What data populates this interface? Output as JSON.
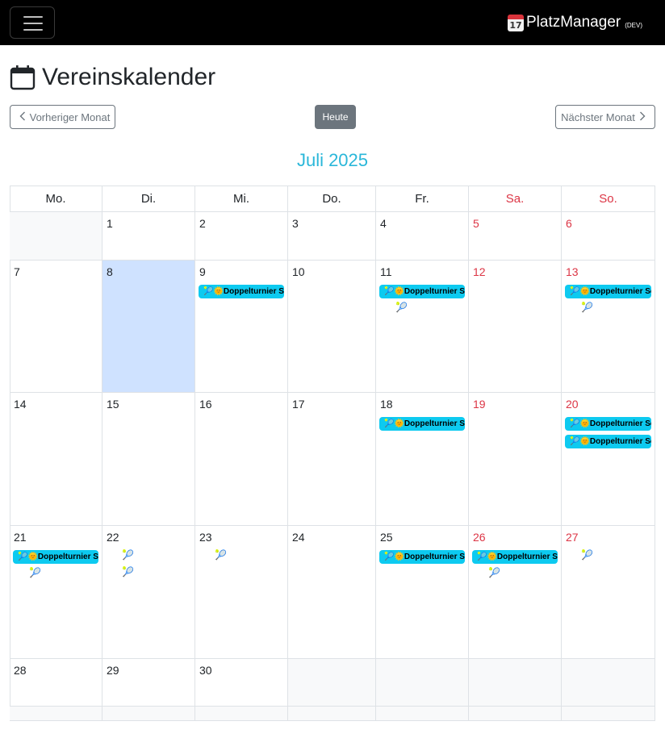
{
  "navbar": {
    "toggle_icon": "hamburger-icon",
    "brand_icon": "calendar-icon",
    "brand_icon_month": "July",
    "brand_icon_day": "17",
    "brand_name": "PlatzManager",
    "brand_tag": "(DEV)"
  },
  "page": {
    "title_icon": "calendar-icon",
    "title": "Vereinskalender"
  },
  "nav": {
    "prev_label": "Vorheriger Monat",
    "today_label": "Heute",
    "next_label": "Nächster Monat",
    "prev_icon": "chevron-left-icon",
    "next_icon": "chevron-right-icon"
  },
  "calendar": {
    "month_title": "Juli 2025",
    "accent_color": "#2ab7d9",
    "event_color": "#0dcaf0",
    "today_color": "#cfe2ff",
    "weekend_color": "#dc3545",
    "weekdays": [
      "Mo.",
      "Di.",
      "Mi.",
      "Do.",
      "Fr.",
      "Sa.",
      "So."
    ],
    "event_title": "🎾🌞Doppelturnier Sommer",
    "event_icon": "tennis-racket-icon",
    "today_day": 8,
    "weeks": [
      [
        {
          "day": "",
          "other": true,
          "events": [],
          "rackets": 0
        },
        {
          "day": "1",
          "events": [],
          "rackets": 0
        },
        {
          "day": "2",
          "events": [],
          "rackets": 0
        },
        {
          "day": "3",
          "events": [],
          "rackets": 0
        },
        {
          "day": "4",
          "events": [],
          "rackets": 0
        },
        {
          "day": "5",
          "weekend": true,
          "events": [],
          "rackets": 0
        },
        {
          "day": "6",
          "weekend": true,
          "events": [],
          "rackets": 0
        }
      ],
      [
        {
          "day": "7",
          "events": [],
          "rackets": 0
        },
        {
          "day": "8",
          "today": true,
          "events": [],
          "rackets": 0
        },
        {
          "day": "9",
          "events": [
            "Doppelturnier Sommer"
          ],
          "rackets": 0
        },
        {
          "day": "10",
          "events": [],
          "rackets": 0
        },
        {
          "day": "11",
          "events": [
            "Doppelturnier Sommer"
          ],
          "rackets": 1
        },
        {
          "day": "12",
          "weekend": true,
          "events": [],
          "rackets": 0
        },
        {
          "day": "13",
          "weekend": true,
          "events": [
            "Doppelturnier Sommer"
          ],
          "rackets": 1
        }
      ],
      [
        {
          "day": "14",
          "events": [],
          "rackets": 0
        },
        {
          "day": "15",
          "events": [],
          "rackets": 0
        },
        {
          "day": "16",
          "events": [],
          "rackets": 0
        },
        {
          "day": "17",
          "events": [],
          "rackets": 0
        },
        {
          "day": "18",
          "events": [
            "Doppelturnier Sommer"
          ],
          "rackets": 0
        },
        {
          "day": "19",
          "weekend": true,
          "events": [],
          "rackets": 0
        },
        {
          "day": "20",
          "weekend": true,
          "events": [
            "Doppelturnier Sommer",
            "Doppelturnier Sommer"
          ],
          "rackets": 0
        }
      ],
      [
        {
          "day": "21",
          "events": [
            "Doppelturnier Sommer"
          ],
          "rackets": 1
        },
        {
          "day": "22",
          "events": [],
          "rackets": 2
        },
        {
          "day": "23",
          "events": [],
          "rackets": 1
        },
        {
          "day": "24",
          "events": [],
          "rackets": 0
        },
        {
          "day": "25",
          "events": [
            "Doppelturnier Sommer"
          ],
          "rackets": 0
        },
        {
          "day": "26",
          "weekend": true,
          "events": [
            "Doppelturnier Sommer"
          ],
          "rackets": 1
        },
        {
          "day": "27",
          "weekend": true,
          "events": [],
          "rackets": 1
        }
      ],
      [
        {
          "day": "28",
          "events": [],
          "rackets": 0
        },
        {
          "day": "29",
          "events": [],
          "rackets": 0
        },
        {
          "day": "30",
          "events": [],
          "rackets": 0
        },
        {
          "day": "",
          "other": true,
          "events": [],
          "rackets": 0
        },
        {
          "day": "",
          "other": true,
          "events": [],
          "rackets": 0
        },
        {
          "day": "",
          "other": true,
          "events": [],
          "rackets": 0
        },
        {
          "day": "",
          "other": true,
          "events": [],
          "rackets": 0
        }
      ],
      [
        {
          "day": "",
          "other": true,
          "events": [],
          "rackets": 0
        },
        {
          "day": "",
          "other": true,
          "events": [],
          "rackets": 0
        },
        {
          "day": "",
          "other": true,
          "events": [],
          "rackets": 0
        },
        {
          "day": "",
          "other": true,
          "events": [],
          "rackets": 0
        },
        {
          "day": "",
          "other": true,
          "events": [],
          "rackets": 0
        },
        {
          "day": "",
          "other": true,
          "events": [],
          "rackets": 0
        },
        {
          "day": "",
          "other": true,
          "events": [],
          "rackets": 0
        }
      ]
    ]
  }
}
